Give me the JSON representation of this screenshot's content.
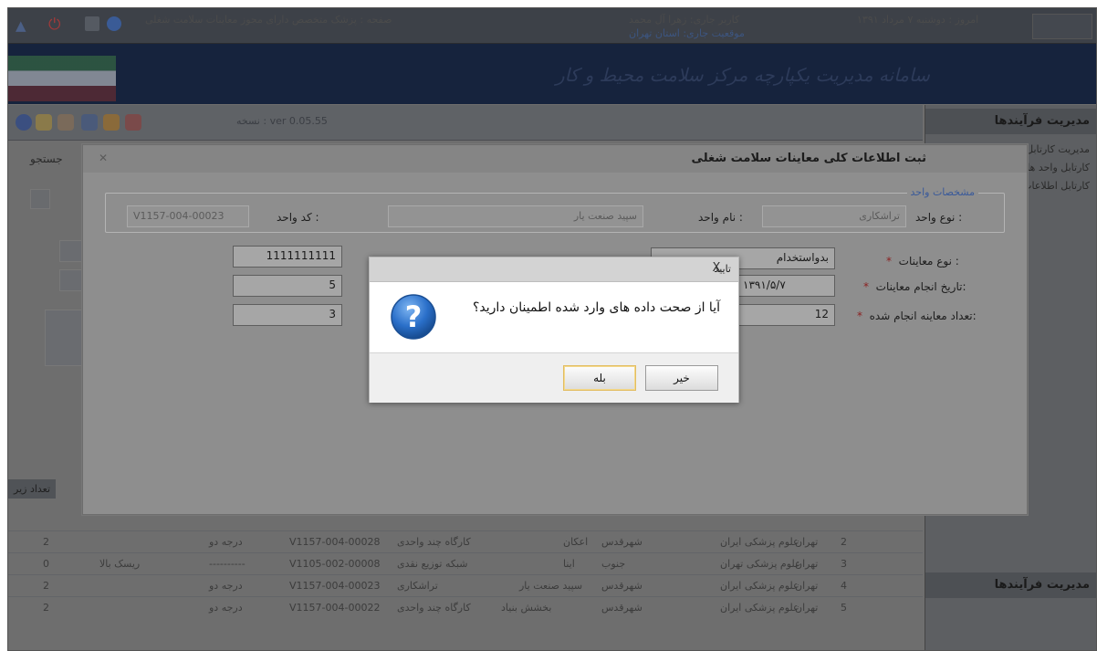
{
  "topbar": {
    "page_label": "صفحه : پزشک متخصص دارای مجوز معاینات سلامت شغلی",
    "user_label": "کاربر جاری: زهرا آل محمد",
    "location_label": "موقعیت جاری: استان تهران",
    "date_label": "امروز : دوشنبه ۷ مرداد ۱۳۹۱"
  },
  "banner": {
    "title": "سامانه مدیریت یکپارچه مرکز سلامت محیط و کار"
  },
  "toolbar": {
    "version_label": "نسخه : ver 0.05.55"
  },
  "right_panel": {
    "header": "مدیریت فرآیندها",
    "items": [
      "مدیریت کارتابل ها",
      "کارتابل واحد ها",
      "کارتابل اطلاعات"
    ],
    "footer_header": "مدیریت فرآیندها"
  },
  "background_grid": {
    "search_label": "جستجو",
    "count_header": "تعداد زیر",
    "rows": [
      {
        "num": "2",
        "province": "تهران",
        "uni": "علوم پزشکی ایران",
        "city": "شهرقدس",
        "name": "اعکان",
        "type": "کارگاه چند واحدی",
        "code": "V1157-004-00028",
        "grade": "درجه دو",
        "extra": "",
        "count": "2"
      },
      {
        "num": "3",
        "province": "تهران",
        "uni": "علوم پزشکی تهران",
        "city": "جنوب",
        "name": "اینا",
        "type": "شبکه توزیع نقدی",
        "code": "V1105-002-00008",
        "grade": "----------",
        "extra": "ریسک بالا",
        "count": "0"
      },
      {
        "num": "4",
        "province": "تهران",
        "uni": "علوم پزشکی ایران",
        "city": "شهرقدس",
        "name": "سپید صنعت یار",
        "type": "تراشکاری",
        "code": "V1157-004-00023",
        "grade": "درجه دو",
        "extra": "",
        "count": "2"
      },
      {
        "num": "5",
        "province": "تهران",
        "uni": "علوم پزشکی ایران",
        "city": "شهرقدس",
        "name": "بخشش بنیاد",
        "type": "کارگاه چند واحدی",
        "code": "V1157-004-00022",
        "grade": "درجه دو",
        "extra": "",
        "count": "2"
      }
    ]
  },
  "modal": {
    "title": "ثبت اطلاعات کلی معاینات سلامت شغلی",
    "unit_legend": "مشخصات واحد",
    "unit_type_label": "نوع واحد :",
    "unit_type_value": "تراشکاری",
    "unit_name_label": "نام واحد :",
    "unit_name_value": "سپید صنعت یار",
    "unit_code_label": "کد واحد :",
    "unit_code_value": "V1157-004-00023",
    "exam_type_label": "نوع معاینات :",
    "exam_type_value": "بدواستخدام",
    "exam_date_label": "تاریخ انجام معاینات:",
    "exam_date_value": "۱۳۹۱/۵/۷",
    "exam_count_label": "تعداد معاینه انجام شده:",
    "exam_count_value": "12",
    "left_field_1": "1111111111",
    "left_field_2": "5",
    "left_field_3": "3",
    "required_mark": "*"
  },
  "dialog": {
    "title": "تایید",
    "message": "آیا از صحت داده های وارد شده اطمینان دارید؟",
    "yes_label": "بله",
    "no_label": "خیر",
    "close_glyph": "X"
  },
  "colors": {
    "dialog_bg": "#ffffff",
    "dialog_footer": "#efefef",
    "yes_focus_border": "#e2bd62",
    "question_icon": "#2a6fc9"
  }
}
